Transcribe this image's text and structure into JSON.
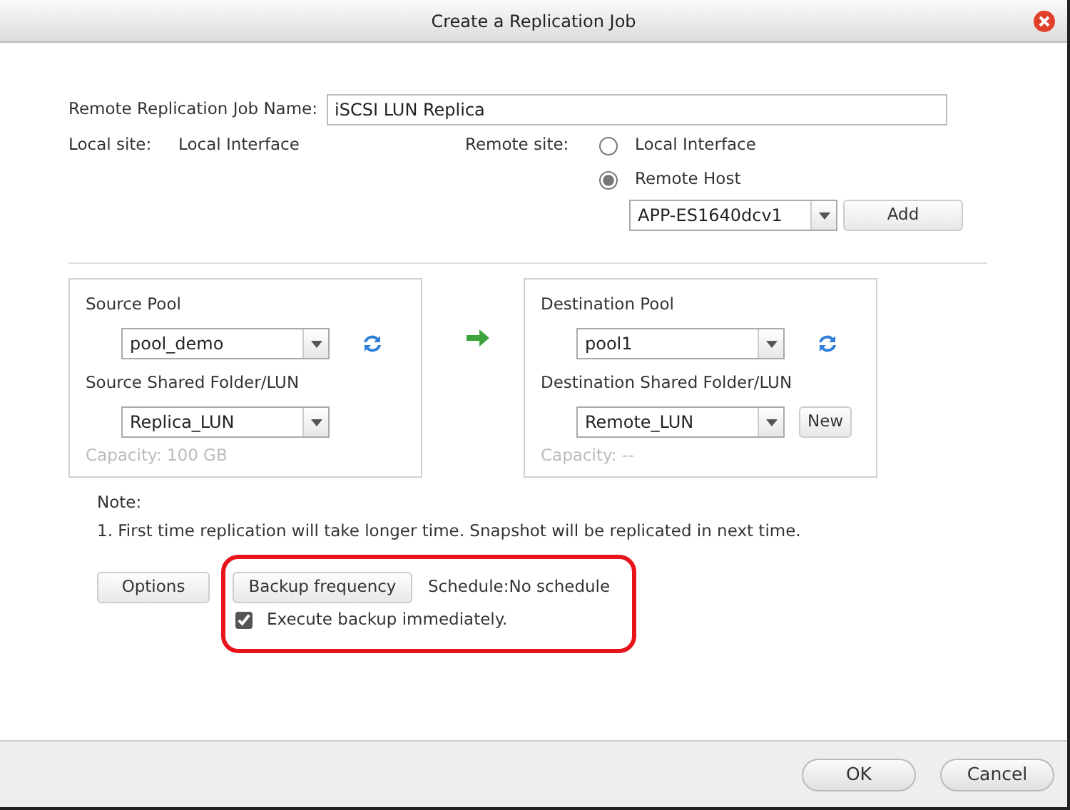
{
  "window": {
    "title": "Create a Replication Job"
  },
  "job_name": {
    "label": "Remote Replication Job Name:",
    "value": "iSCSI LUN Replica"
  },
  "local_site": {
    "label": "Local site:",
    "value": "Local Interface"
  },
  "remote_site": {
    "label": "Remote site:",
    "options": [
      {
        "label": "Local Interface",
        "selected": false
      },
      {
        "label": "Remote Host",
        "selected": true
      }
    ],
    "host": "APP-ES1640dcv1",
    "add_button": "Add"
  },
  "source": {
    "pool_label": "Source Pool",
    "pool": "pool_demo",
    "folder_label": "Source Shared Folder/LUN",
    "folder": "Replica_LUN",
    "capacity": "Capacity: 100 GB"
  },
  "destination": {
    "pool_label": "Destination Pool",
    "pool": "pool1",
    "folder_label": "Destination Shared Folder/LUN",
    "folder": "Remote_LUN",
    "new_button": "New",
    "capacity": "Capacity: --"
  },
  "note": {
    "title": "Note:",
    "lines": [
      "1. First time replication will take longer time. Snapshot will be replicated in next time."
    ]
  },
  "options_button": "Options",
  "frequency_button": "Backup frequency",
  "schedule": "Schedule:No schedule",
  "execute": {
    "label": "Execute backup immediately.",
    "checked": true
  },
  "buttons": [
    "OK",
    "Cancel"
  ]
}
